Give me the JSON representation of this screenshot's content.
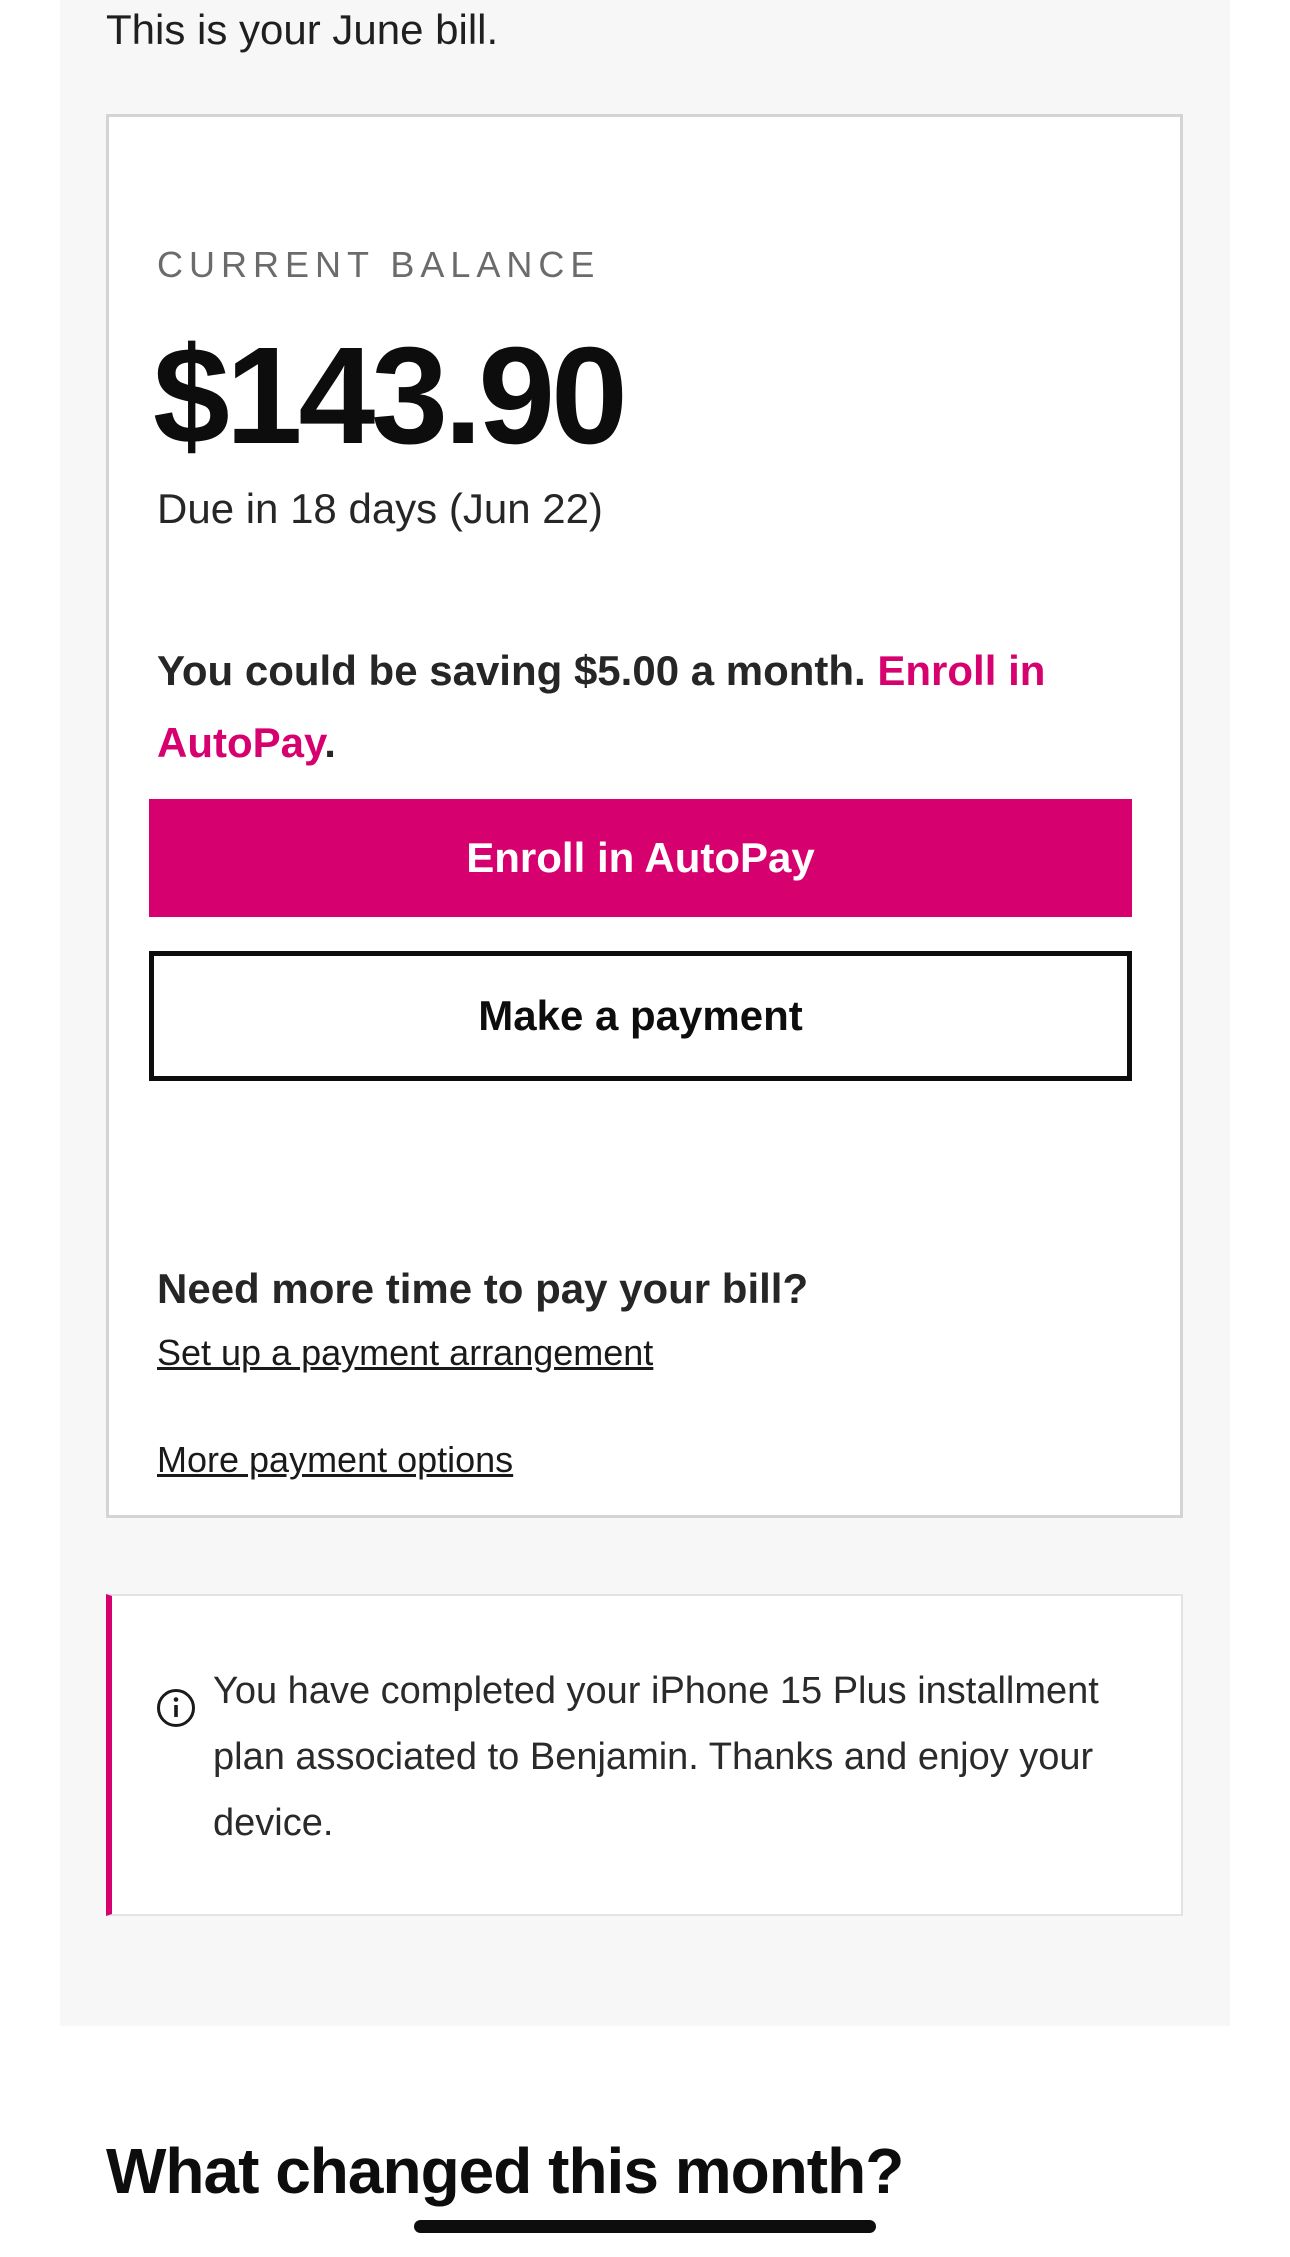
{
  "intro_text": "This is your June bill.",
  "balance": {
    "label": "CURRENT BALANCE",
    "amount": "$143.90",
    "due_text": "Due in 18 days (Jun 22)"
  },
  "savings": {
    "text": "You could be saving $5.00 a month. ",
    "link_text": "Enroll in AutoPay",
    "trailing": "."
  },
  "buttons": {
    "autopay_label": "Enroll in AutoPay",
    "payment_label": "Make a payment"
  },
  "arrangement": {
    "question": "Need more time to pay your bill?",
    "link_text": "Set up a payment arrangement"
  },
  "more_options_link": "More payment options",
  "notice": {
    "icon": "info-icon",
    "text": "You have completed your iPhone 15 Plus installment plan associated to Benjamin. Thanks and enjoy your device."
  },
  "section_heading": "What changed this month?",
  "colors": {
    "accent": "#d6006f",
    "panel_bg": "#f7f7f7",
    "text": "#1a1a1a"
  }
}
